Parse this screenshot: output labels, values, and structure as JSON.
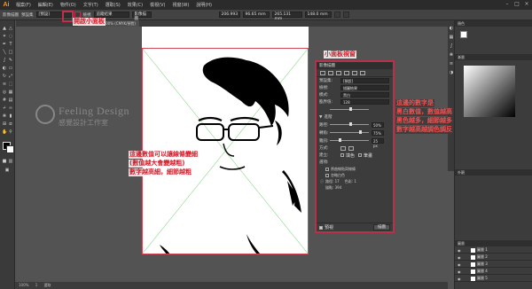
{
  "app": {
    "logo": "Ai",
    "menus": [
      "檔案(F)",
      "編輯(E)",
      "物件(O)",
      "文字(T)",
      "選取(S)",
      "效果(C)",
      "檢視(V)",
      "視窗(W)",
      "說明(H)"
    ]
  },
  "control_bar": {
    "selection_label": "影像描圖",
    "preset_label": "預設集",
    "preset_value": "[預設]",
    "view_label": "檢視",
    "view_value": "追蹤結果",
    "trace_button": "影像描圖",
    "x_value": "206.993",
    "y_value": "96.65 mm",
    "w_value": "265.131 mm",
    "h_value": "148.0 mm"
  },
  "document": {
    "tab_title": "未命名-1* @ 100% (CMYK/預覽)"
  },
  "trace_panel": {
    "title": "影像描圖",
    "preset_label": "預設集:",
    "preset_value": "[預設]",
    "view_label": "檢視:",
    "view_value": "描圖結果",
    "mode_label": "模式:",
    "mode_value": "黑白",
    "palette_label": "臨界值:",
    "palette_value": "128",
    "advanced_label": "進階",
    "path_label": "路徑:",
    "path_value": "50%",
    "corner_label": "轉角:",
    "corner_value": "75%",
    "noise_label": "雜訊:",
    "noise_value": "25 px",
    "method_label": "方式:",
    "create_label": "建立:",
    "fill_label": "填色",
    "stroke_label": "筆畫",
    "options_label": "選項:",
    "opt_curve": "將曲線貼齊線條",
    "opt_ignore": "忽略白色",
    "paths_label": "路徑: 17",
    "anchors_label": "錨點: 394",
    "colors_label": "色彩: 1",
    "preview_label": "預視",
    "trace_button": "描圖"
  },
  "callouts": {
    "open_panel": "開啟小面板",
    "panel_title": "小面板視窗",
    "line_1": "這邊數值可以讓線條變細",
    "line_2": "(數值越大會變越粗)",
    "line_3": "數字越高細，細節越粗",
    "right_1": "這邊的數字是",
    "right_2": "黑白數值，數值越高",
    "right_3": "黑色越多，細節越多",
    "right_4": "數字越高越調色調反"
  },
  "watermark": {
    "title": "Feeling Design",
    "subtitle": "感覺設計工作室"
  },
  "dock": {
    "color_tab": "顏色",
    "gradient_tab": "漸層",
    "appearance_tab": "外觀",
    "layers_tab": "圖層",
    "layers": [
      "圖層 1",
      "圖層 2",
      "圖層 3",
      "圖層 4",
      "圖層 5"
    ]
  },
  "status": {
    "zoom": "100%",
    "page": "1",
    "info": "選取"
  },
  "colors": {
    "callout": "#c0304a",
    "callout_text": "#d11c2a",
    "panel_bg": "#3c3c3c",
    "app_bg": "#535353"
  }
}
